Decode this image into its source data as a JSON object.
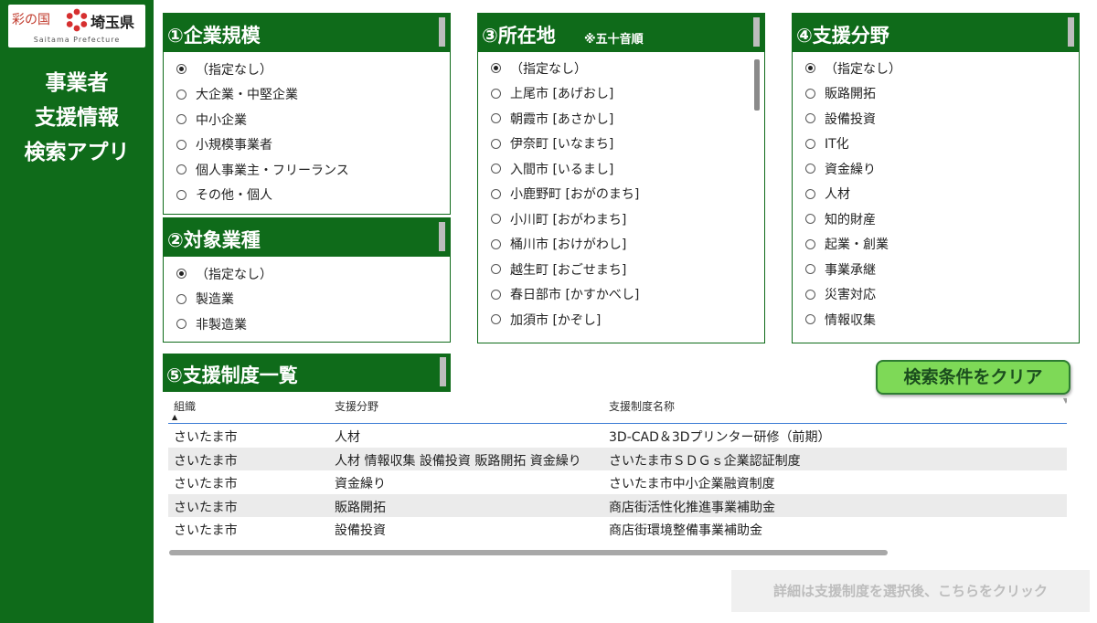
{
  "logo": {
    "script_text": "彩の国",
    "pref_text": "埼玉県",
    "sub_text": "Saitama Prefecture"
  },
  "app_title": [
    "事業者",
    "支援情報",
    "検索アプリ"
  ],
  "panels": {
    "scale": {
      "title": "①企業規模",
      "options": [
        "（指定なし）",
        "大企業・中堅企業",
        "中小企業",
        "小規模事業者",
        "個人事業主・フリーランス",
        "その他・個人"
      ],
      "selected": 0
    },
    "industry": {
      "title": "②対象業種",
      "options": [
        "（指定なし）",
        "製造業",
        "非製造業"
      ],
      "selected": 0
    },
    "location": {
      "title": "③所在地",
      "note": "※五十音順",
      "options": [
        "（指定なし）",
        "上尾市 [あげおし]",
        "朝霞市 [あさかし]",
        "伊奈町 [いなまち]",
        "入間市 [いるまし]",
        "小鹿野町 [おがのまち]",
        "小川町 [おがわまち]",
        "桶川市 [おけがわし]",
        "越生町 [おごせまち]",
        "春日部市 [かすかべし]",
        "加須市 [かぞし]"
      ],
      "selected": 0
    },
    "field": {
      "title": "④支援分野",
      "options": [
        "（指定なし）",
        "販路開拓",
        "設備投資",
        "IT化",
        "資金繰り",
        "人材",
        "知的財産",
        "起業・創業",
        "事業承継",
        "災害対応",
        "情報収集"
      ],
      "selected": 0
    }
  },
  "list": {
    "title": "⑤支援制度一覧",
    "columns": [
      "組織",
      "支援分野",
      "支援制度名称"
    ],
    "rows": [
      [
        "さいたま市",
        "人材",
        "3D-CAD＆3Dプリンター研修（前期）"
      ],
      [
        "さいたま市",
        "人材 情報収集 設備投資 販路開拓 資金繰り",
        "さいたま市ＳＤＧｓ企業認証制度"
      ],
      [
        "さいたま市",
        "資金繰り",
        "さいたま市中小企業融資制度"
      ],
      [
        "さいたま市",
        "販路開拓",
        "商店街活性化推進事業補助金"
      ],
      [
        "さいたま市",
        "設備投資",
        "商店街環境整備事業補助金"
      ]
    ]
  },
  "buttons": {
    "clear": "検索条件をクリア",
    "detail": "詳細は支援制度を選択後、こちらをクリック"
  }
}
